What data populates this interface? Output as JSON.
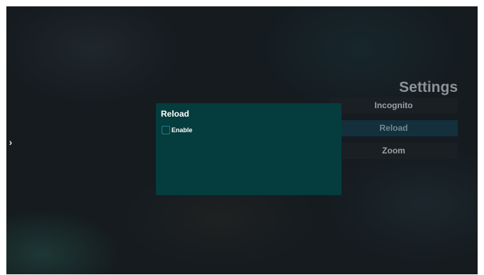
{
  "settings_panel": {
    "title": "Settings",
    "menu_items": [
      {
        "label": "Incognito",
        "selected": false
      },
      {
        "label": "Reload",
        "selected": true
      },
      {
        "label": "Zoom",
        "selected": false
      }
    ]
  },
  "dialog": {
    "title": "Reload",
    "option_label": "Enable",
    "option_checked": false
  },
  "icons": {
    "left_arrow": "chevron-right-icon"
  },
  "colors": {
    "background": "#151b1f",
    "dialog_background": "#053c3e",
    "selected_item_background": "#13303c",
    "checkbox_border": "#1f7e86"
  }
}
